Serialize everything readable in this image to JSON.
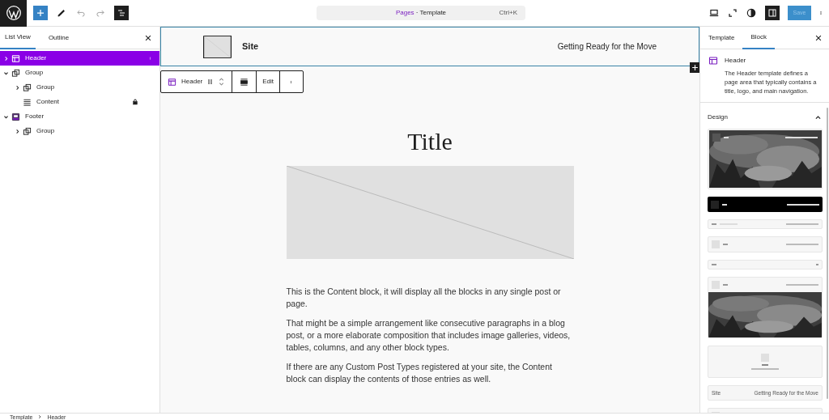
{
  "toolbar": {
    "command_bar": {
      "parent": "Pages",
      "separator": "·",
      "current": "Template",
      "shortcut": "Ctrl+K"
    },
    "save": {
      "label": "Save",
      "disabled": true
    }
  },
  "left_panel": {
    "tabs": [
      {
        "label": "List View",
        "selected": true
      },
      {
        "label": "Outline",
        "selected": false
      }
    ],
    "tree": [
      {
        "label": "Header",
        "kind": "template-part",
        "selected": true,
        "expanded": false
      },
      {
        "label": "Group",
        "kind": "group",
        "selected": false,
        "expanded": true,
        "children": [
          {
            "label": "Group",
            "kind": "group",
            "selected": false,
            "expanded": false
          },
          {
            "label": "Content",
            "kind": "content",
            "selected": false,
            "locked": true
          }
        ]
      },
      {
        "label": "Footer",
        "kind": "footer",
        "selected": false,
        "expanded": true,
        "children": [
          {
            "label": "Group",
            "kind": "group",
            "selected": false,
            "expanded": false
          }
        ]
      }
    ]
  },
  "canvas": {
    "header": {
      "site": "Site",
      "tagline": "Getting Ready for the Move"
    },
    "block_toolbar": {
      "block": "Header",
      "edit": "Edit"
    },
    "title": "Title",
    "paragraphs": [
      "This is the Content block, it will display all the blocks in any single post or page.",
      "That might be a simple arrangement like consecutive paragraphs in a blog post, or a more elaborate composition that includes image galleries, videos, tables, columns, and any other block types.",
      "If there are any Custom Post Types registered at your site, the Content block can display the contents of those entries as well."
    ]
  },
  "right_panel": {
    "tabs": [
      {
        "label": "Template",
        "selected": false
      },
      {
        "label": "Block",
        "selected": true
      }
    ],
    "block": {
      "name": "Header",
      "description": "The Header template defines a page area that typically contains a title, logo, and main navigation."
    },
    "section": {
      "title": "Design",
      "expanded": true
    },
    "patterns": [
      {
        "kind": "photo-top"
      },
      {
        "kind": "dark"
      },
      {
        "kind": "inline"
      },
      {
        "kind": "logo-stack"
      },
      {
        "kind": "minimal"
      },
      {
        "kind": "photo-below"
      },
      {
        "kind": "centered"
      },
      {
        "kind": "plain",
        "site": "Site",
        "tagline": "Getting Ready for the Move"
      },
      {
        "kind": "logo"
      }
    ]
  },
  "breadcrumb": [
    "Template",
    "Header"
  ]
}
